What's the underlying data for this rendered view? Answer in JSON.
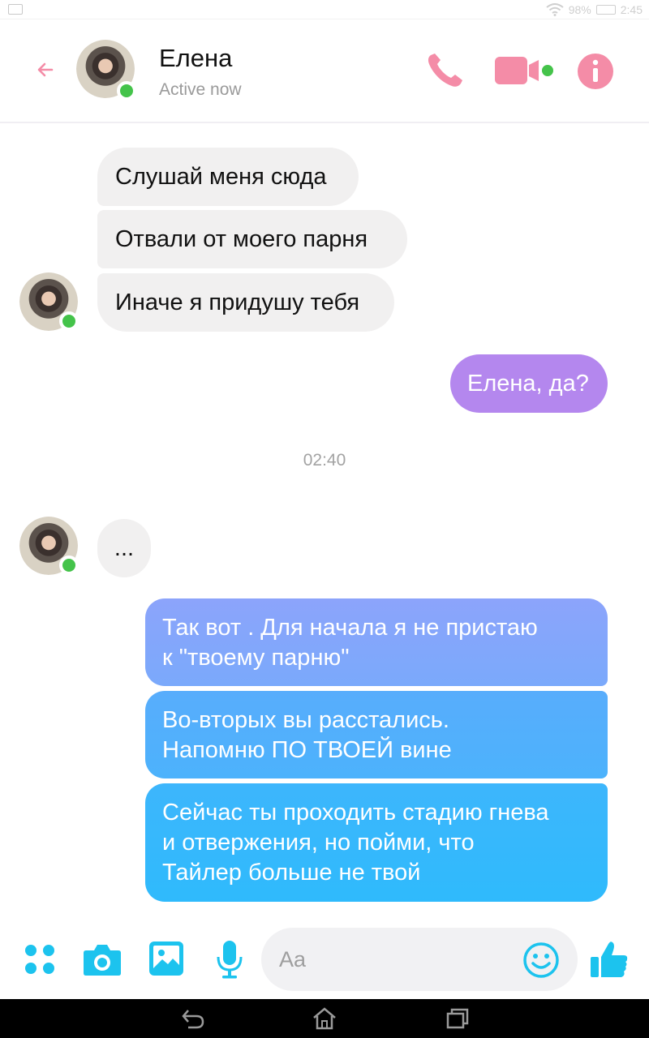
{
  "status_bar": {
    "battery": "98%",
    "time": "2:45"
  },
  "header": {
    "contact_name": "Елена",
    "presence": "Active now",
    "icons": [
      "back-arrow-icon",
      "phone-icon",
      "video-camera-icon",
      "info-icon"
    ]
  },
  "messages": [
    {
      "side": "in",
      "text": "Слушай меня сюда"
    },
    {
      "side": "in",
      "text": "Отвали от моего парня"
    },
    {
      "side": "in",
      "text": "Иначе я придушу тебя"
    },
    {
      "side": "out",
      "text": "Елена, да?"
    },
    {
      "side": "in",
      "text": "..."
    },
    {
      "side": "out",
      "lines": [
        "Так вот . Для начала я не пристаю",
        "к \"твоему парню\""
      ]
    },
    {
      "side": "out",
      "lines": [
        "Во-вторых вы расстались.",
        "Напомню ПО ТВОЕЙ вине"
      ]
    },
    {
      "side": "out",
      "lines": [
        "Сейчас ты проходить стадию гнева",
        "и отвержения, но пойми, что",
        "Тайлер больше не твой"
      ]
    }
  ],
  "timestamp": "02:40",
  "composer": {
    "placeholder": "Aa",
    "icons": [
      "apps-grid-icon",
      "camera-icon",
      "gallery-icon",
      "microphone-icon",
      "emoji-icon",
      "thumbs-up-icon"
    ]
  },
  "colors": {
    "accent_pink": "#f48ca7",
    "online_green": "#44c34a",
    "incoming_bubble": "#f1f0f0",
    "outgoing_purple": "#b487ee",
    "outgoing_blue_top": "#8ca4fb",
    "outgoing_blue_bottom": "#2fbafc",
    "composer_accent": "#1cc3ee"
  }
}
